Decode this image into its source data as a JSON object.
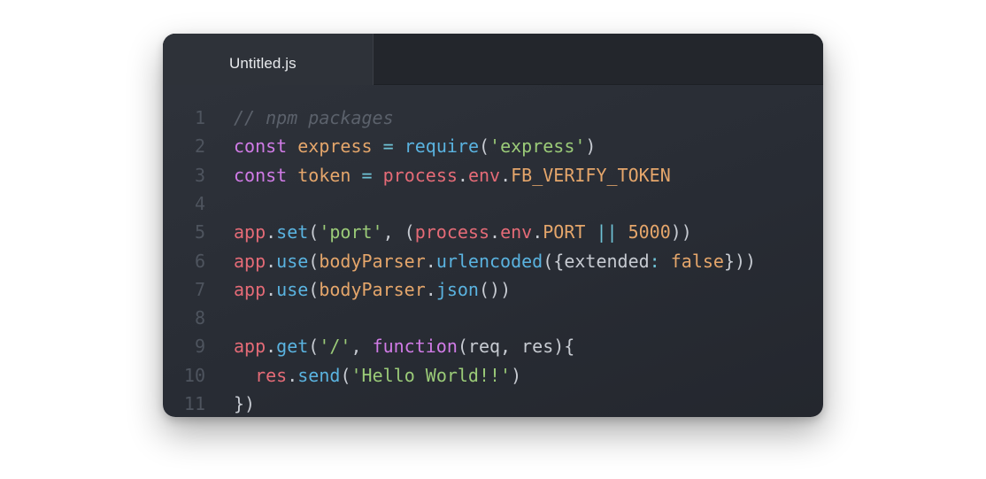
{
  "tab": {
    "title": "Untitled.js"
  },
  "colors": {
    "comment": "#5b616b",
    "keyword": "#d07be6",
    "variable": "#e5a66b",
    "operator": "#6fc3d6",
    "function": "#5ab3e0",
    "string": "#9bcb78",
    "object": "#e56b77",
    "plain": "#c7cbd2",
    "line_number": "#4e545e"
  },
  "editor": {
    "lines": [
      {
        "number": "1",
        "tokens": [
          {
            "text": "// npm packages",
            "type": "comment"
          }
        ]
      },
      {
        "number": "2",
        "tokens": [
          {
            "text": "const",
            "type": "keyword"
          },
          {
            "text": " ",
            "type": "punct"
          },
          {
            "text": "express",
            "type": "var"
          },
          {
            "text": " ",
            "type": "punct"
          },
          {
            "text": "=",
            "type": "op"
          },
          {
            "text": " ",
            "type": "punct"
          },
          {
            "text": "require",
            "type": "fn"
          },
          {
            "text": "(",
            "type": "punct"
          },
          {
            "text": "'express'",
            "type": "str"
          },
          {
            "text": ")",
            "type": "punct"
          }
        ]
      },
      {
        "number": "3",
        "tokens": [
          {
            "text": "const",
            "type": "keyword"
          },
          {
            "text": " ",
            "type": "punct"
          },
          {
            "text": "token",
            "type": "var"
          },
          {
            "text": " ",
            "type": "punct"
          },
          {
            "text": "=",
            "type": "op"
          },
          {
            "text": " ",
            "type": "punct"
          },
          {
            "text": "process",
            "type": "obj"
          },
          {
            "text": ".",
            "type": "punct"
          },
          {
            "text": "env",
            "type": "obj"
          },
          {
            "text": ".",
            "type": "punct"
          },
          {
            "text": "FB_VERIFY_TOKEN",
            "type": "const"
          }
        ]
      },
      {
        "number": "4",
        "tokens": []
      },
      {
        "number": "5",
        "tokens": [
          {
            "text": "app",
            "type": "obj"
          },
          {
            "text": ".",
            "type": "punct"
          },
          {
            "text": "set",
            "type": "fn"
          },
          {
            "text": "(",
            "type": "punct"
          },
          {
            "text": "'port'",
            "type": "str"
          },
          {
            "text": ", (",
            "type": "punct"
          },
          {
            "text": "process",
            "type": "obj"
          },
          {
            "text": ".",
            "type": "punct"
          },
          {
            "text": "env",
            "type": "obj"
          },
          {
            "text": ".",
            "type": "punct"
          },
          {
            "text": "PORT",
            "type": "const"
          },
          {
            "text": " ",
            "type": "punct"
          },
          {
            "text": "||",
            "type": "op"
          },
          {
            "text": " ",
            "type": "punct"
          },
          {
            "text": "5000",
            "type": "num"
          },
          {
            "text": "))",
            "type": "punct"
          }
        ]
      },
      {
        "number": "6",
        "tokens": [
          {
            "text": "app",
            "type": "obj"
          },
          {
            "text": ".",
            "type": "punct"
          },
          {
            "text": "use",
            "type": "fn"
          },
          {
            "text": "(",
            "type": "punct"
          },
          {
            "text": "bodyParser",
            "type": "var"
          },
          {
            "text": ".",
            "type": "punct"
          },
          {
            "text": "urlencoded",
            "type": "fn"
          },
          {
            "text": "({extended",
            "type": "punct"
          },
          {
            "text": ":",
            "type": "op"
          },
          {
            "text": " ",
            "type": "punct"
          },
          {
            "text": "false",
            "type": "num"
          },
          {
            "text": "}))",
            "type": "punct"
          }
        ]
      },
      {
        "number": "7",
        "tokens": [
          {
            "text": "app",
            "type": "obj"
          },
          {
            "text": ".",
            "type": "punct"
          },
          {
            "text": "use",
            "type": "fn"
          },
          {
            "text": "(",
            "type": "punct"
          },
          {
            "text": "bodyParser",
            "type": "var"
          },
          {
            "text": ".",
            "type": "punct"
          },
          {
            "text": "json",
            "type": "fn"
          },
          {
            "text": "())",
            "type": "punct"
          }
        ]
      },
      {
        "number": "8",
        "tokens": []
      },
      {
        "number": "9",
        "tokens": [
          {
            "text": "app",
            "type": "obj"
          },
          {
            "text": ".",
            "type": "punct"
          },
          {
            "text": "get",
            "type": "fn"
          },
          {
            "text": "(",
            "type": "punct"
          },
          {
            "text": "'/'",
            "type": "str"
          },
          {
            "text": ", ",
            "type": "punct"
          },
          {
            "text": "function",
            "type": "keyword"
          },
          {
            "text": "(req, res){",
            "type": "punct"
          }
        ]
      },
      {
        "number": "10",
        "tokens": [
          {
            "text": "  ",
            "type": "punct"
          },
          {
            "text": "res",
            "type": "obj"
          },
          {
            "text": ".",
            "type": "punct"
          },
          {
            "text": "send",
            "type": "fn"
          },
          {
            "text": "(",
            "type": "punct"
          },
          {
            "text": "'Hello World!!'",
            "type": "str"
          },
          {
            "text": ")",
            "type": "punct"
          }
        ]
      },
      {
        "number": "11",
        "tokens": [
          {
            "text": "})",
            "type": "punct"
          }
        ]
      }
    ]
  }
}
